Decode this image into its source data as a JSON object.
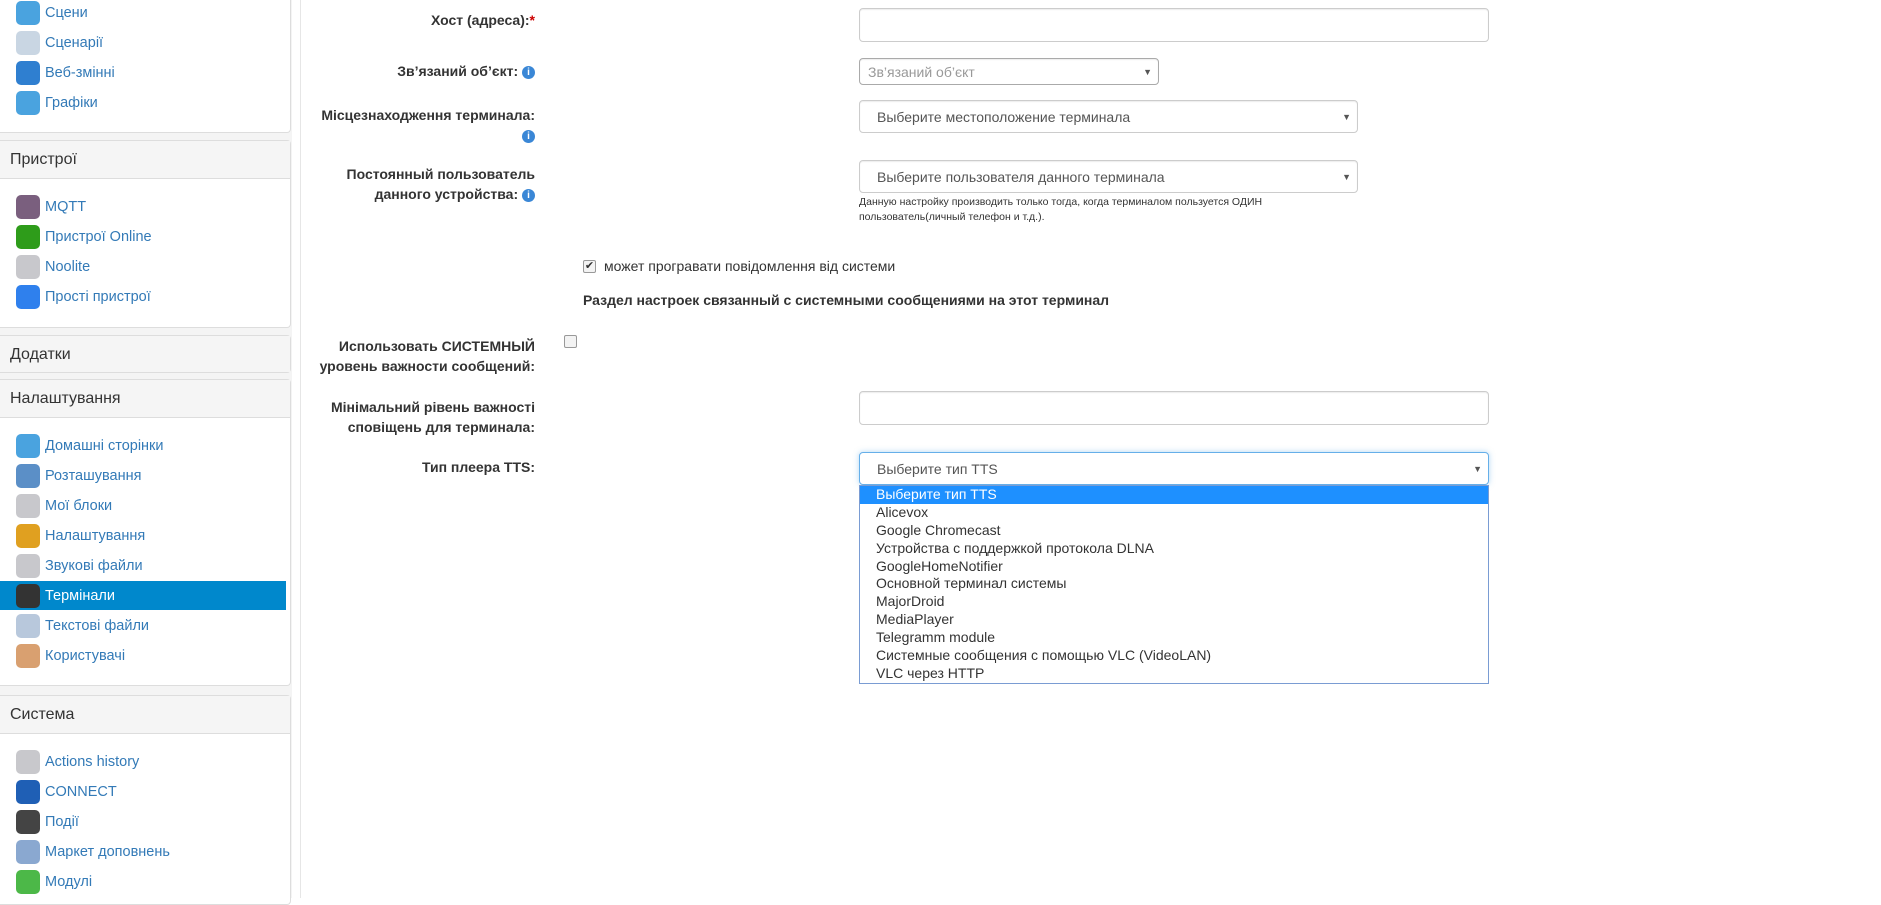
{
  "sidebar": {
    "panel_top": {
      "items": [
        {
          "label": "Сцени",
          "icon": "scenes-icon",
          "color": "#4aa3df"
        },
        {
          "label": "Сценарії",
          "icon": "scenarios-icon",
          "color": "#c9d6e3"
        },
        {
          "label": "Веб-змінні",
          "icon": "globe-gear-icon",
          "color": "#2f7fd0"
        },
        {
          "label": "Графіки",
          "icon": "chart-icon",
          "color": "#4aa3df"
        }
      ]
    },
    "devices": {
      "title": "Пристрої",
      "items": [
        {
          "label": "MQTT",
          "icon": "mqtt-cloud-icon",
          "color": "#7a5f7e"
        },
        {
          "label": "Пристрої Online",
          "icon": "online-dot-icon",
          "color": "#2e9c1a"
        },
        {
          "label": "Noolite",
          "icon": "module-m-icon",
          "color": "#c8c8cc"
        },
        {
          "label": "Прості пристрої",
          "icon": "power-icon",
          "color": "#2f80ed"
        }
      ]
    },
    "addons": {
      "title": "Додатки"
    },
    "settings": {
      "title": "Налаштування",
      "items": [
        {
          "label": "Домашні сторінки",
          "icon": "document-icon",
          "color": "#4aa3df"
        },
        {
          "label": "Розташування",
          "icon": "folder-home-icon",
          "color": "#5b8fc7"
        },
        {
          "label": "Мої блоки",
          "icon": "module-m-icon",
          "color": "#c8c8cc"
        },
        {
          "label": "Налаштування",
          "icon": "tools-icon",
          "color": "#e0a020"
        },
        {
          "label": "Звукові файли",
          "icon": "module-m-icon",
          "color": "#c8c8cc"
        },
        {
          "label": "Термінали",
          "icon": "monitor-icon",
          "color": "#333"
        },
        {
          "label": "Текстові файли",
          "icon": "notebook-icon",
          "color": "#b8c8dc"
        },
        {
          "label": "Користувачі",
          "icon": "users-icon",
          "color": "#d9a070"
        }
      ]
    },
    "system": {
      "title": "Система",
      "items": [
        {
          "label": "Actions history",
          "icon": "module-m-icon",
          "color": "#c8c8cc"
        },
        {
          "label": "CONNECT",
          "icon": "globe-icon",
          "color": "#1f5fb5"
        },
        {
          "label": "Події",
          "icon": "laptop-icon",
          "color": "#444"
        },
        {
          "label": "Маркет доповнень",
          "icon": "market-icon",
          "color": "#8aa8d0"
        },
        {
          "label": "Модулі",
          "icon": "puzzle-icon",
          "color": "#4cb848"
        }
      ]
    }
  },
  "form": {
    "host": {
      "label": "Хост (адреса):",
      "required": "*",
      "value": ""
    },
    "linked": {
      "label": "Зв’язаний об’єкт:",
      "placeholder": "Зв’язаний об’єкт"
    },
    "location": {
      "label": "Місцезнаходження терминала:",
      "value": "Выберите местоположение терминала"
    },
    "user": {
      "label1": "Постоянный пользователь",
      "label2": "данного устройства:",
      "value": "Выберите пользователя данного терминала",
      "help1": "Данную настройку производить только тогда, когда терминалом пользуется ОДИН",
      "help2": "пользователь(личный телефон и т.д.)."
    },
    "can_play": {
      "label": "может програвати повідомлення від системи",
      "checked": true
    },
    "section_heading": "Раздел настроек связанный с системными сообщениями на этот терминал",
    "use_system": {
      "label1": "Использовать СИСТЕМНЫЙ",
      "label2": "уровень важности сообщений:",
      "checked": false
    },
    "min_level": {
      "label1": "Мінімальний рівень важності",
      "label2": "сповіщень для терминала:",
      "value": ""
    },
    "tts": {
      "label": "Тип плеера TTS:",
      "value": "Выберите тип TTS",
      "options": [
        "Выберите тип TTS",
        "Alicevox",
        "Google Chromecast",
        "Устройства с поддержкой протокола DLNA",
        "GoogleHomeNotifier",
        "Основной терминал системы",
        "MajorDroid",
        "MediaPlayer",
        "Telegramm module",
        "Системные сообщения с помощью VLC (VideoLAN)",
        "VLC через HTTP"
      ],
      "selected_index": 0
    }
  },
  "colors": {
    "active": "#0088cc",
    "link": "#337ab7",
    "highlight": "#1e90ff"
  }
}
